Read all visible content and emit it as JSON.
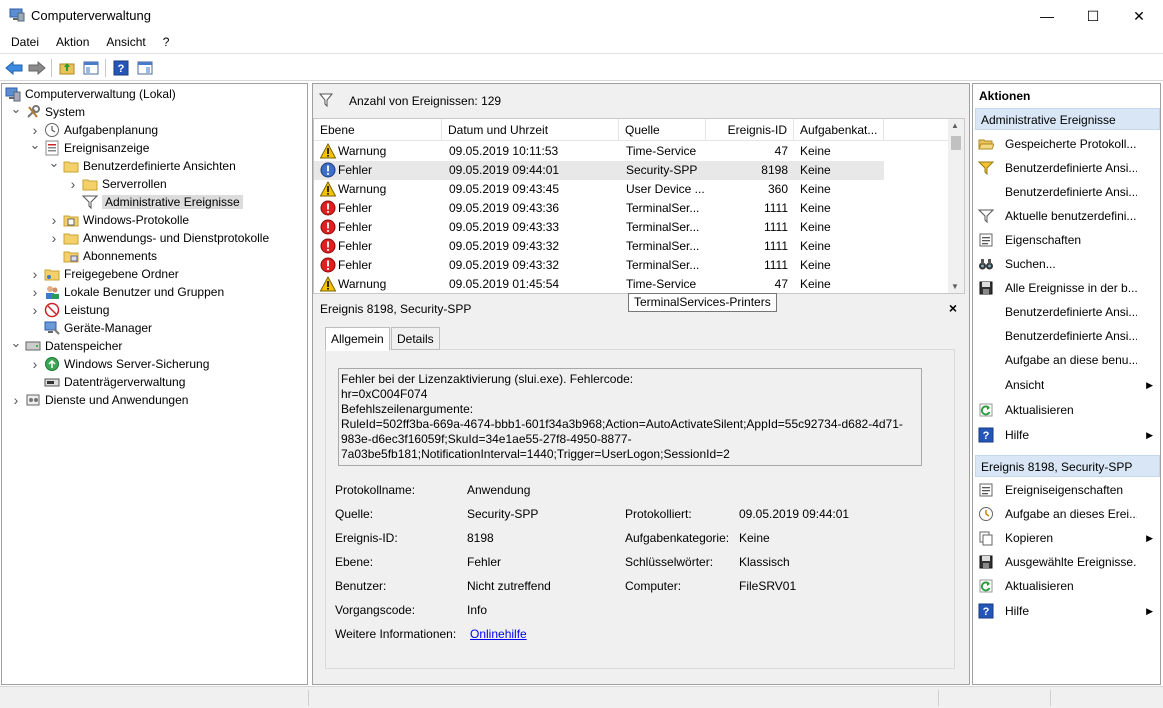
{
  "window": {
    "title": "Computerverwaltung",
    "minimize": "—",
    "maximize": "☐",
    "close": "✕"
  },
  "menu": [
    "Datei",
    "Aktion",
    "Ansicht",
    "?"
  ],
  "tree": {
    "items": [
      {
        "label": "Computerverwaltung (Lokal)",
        "level": 0,
        "exp": "",
        "icon": "computer-management-icon"
      },
      {
        "label": "System",
        "level": 1,
        "exp": "open",
        "icon": "tools-icon"
      },
      {
        "label": "Aufgabenplanung",
        "level": 2,
        "exp": "closed",
        "icon": "clock-icon"
      },
      {
        "label": "Ereignisanzeige",
        "level": 2,
        "exp": "open",
        "icon": "event-viewer-icon"
      },
      {
        "label": "Benutzerdefinierte Ansichten",
        "level": 3,
        "exp": "open",
        "icon": "folder-icon"
      },
      {
        "label": "Serverrollen",
        "level": 4,
        "exp": "closed",
        "icon": "folder-icon"
      },
      {
        "label": "Administrative Ereignisse",
        "level": 4,
        "exp": "",
        "icon": "filter-icon",
        "selected": true
      },
      {
        "label": "Windows-Protokolle",
        "level": 3,
        "exp": "closed",
        "icon": "log-folder-icon"
      },
      {
        "label": "Anwendungs- und Dienstprotokolle",
        "level": 3,
        "exp": "closed",
        "icon": "folder-icon"
      },
      {
        "label": "Abonnements",
        "level": 3,
        "exp": "",
        "icon": "subscription-icon"
      },
      {
        "label": "Freigegebene Ordner",
        "level": 2,
        "exp": "closed",
        "icon": "shared-folder-icon"
      },
      {
        "label": "Lokale Benutzer und Gruppen",
        "level": 2,
        "exp": "closed",
        "icon": "users-icon"
      },
      {
        "label": "Leistung",
        "level": 2,
        "exp": "closed",
        "icon": "performance-icon"
      },
      {
        "label": "Geräte-Manager",
        "level": 2,
        "exp": "",
        "icon": "device-manager-icon"
      },
      {
        "label": "Datenspeicher",
        "level": 1,
        "exp": "open",
        "icon": "storage-icon"
      },
      {
        "label": "Windows Server-Sicherung",
        "level": 2,
        "exp": "closed",
        "icon": "backup-icon"
      },
      {
        "label": "Datenträgerverwaltung",
        "level": 2,
        "exp": "",
        "icon": "disk-icon"
      },
      {
        "label": "Dienste und Anwendungen",
        "level": 1,
        "exp": "closed",
        "icon": "services-icon"
      }
    ]
  },
  "events": {
    "count_label": "Anzahl von Ereignissen: 129",
    "columns": [
      "Ebene",
      "Datum und Uhrzeit",
      "Quelle",
      "Ereignis-ID",
      "Aufgabenkat..."
    ],
    "rows": [
      {
        "level": "Warnung",
        "type": "warning",
        "date": "09.05.2019 10:11:53",
        "source": "Time-Service",
        "id": "47",
        "task": "Keine"
      },
      {
        "level": "Fehler",
        "type": "error-blue",
        "date": "09.05.2019 09:44:01",
        "source": "Security-SPP",
        "id": "8198",
        "task": "Keine"
      },
      {
        "level": "Warnung",
        "type": "warning",
        "date": "09.05.2019 09:43:45",
        "source": "User Device ...",
        "id": "360",
        "task": "Keine"
      },
      {
        "level": "Fehler",
        "type": "error",
        "date": "09.05.2019 09:43:36",
        "source": "TerminalSer...",
        "id": "1111",
        "task": "Keine"
      },
      {
        "level": "Fehler",
        "type": "error",
        "date": "09.05.2019 09:43:33",
        "source": "TerminalSer...",
        "id": "1111",
        "task": "Keine"
      },
      {
        "level": "Fehler",
        "type": "error",
        "date": "09.05.2019 09:43:32",
        "source": "TerminalSer...",
        "id": "1111",
        "task": "Keine"
      },
      {
        "level": "Fehler",
        "type": "error",
        "date": "09.05.2019 09:43:32",
        "source": "TerminalSer...",
        "id": "1111",
        "task": "Keine"
      },
      {
        "level": "Warnung",
        "type": "warning",
        "date": "09.05.2019 01:45:54",
        "source": "Time-Service",
        "id": "47",
        "task": "Keine"
      }
    ],
    "tooltip": "TerminalServices-Printers"
  },
  "detail": {
    "title": "Ereignis 8198, Security-SPP",
    "close": "×",
    "tabs": [
      "Allgemein",
      "Details"
    ],
    "message": "Fehler bei der Lizenzaktivierung (slui.exe). Fehlercode:\nhr=0xC004F074\nBefehlszeilenargumente:\nRuleId=502ff3ba-669a-4674-bbb1-601f34a3b968;Action=AutoActivateSilent;AppId=55c92734-d682-4d71-983e-d6ec3f16059f;SkuId=34e1ae55-27f8-4950-8877-7a03be5fb181;NotificationInterval=1440;Trigger=UserLogon;SessionId=2",
    "fields": {
      "protokollname_label": "Protokollname:",
      "protokollname": "Anwendung",
      "quelle_label": "Quelle:",
      "quelle": "Security-SPP",
      "protokolliert_label": "Protokolliert:",
      "protokolliert": "09.05.2019 09:44:01",
      "ereignisid_label": "Ereignis-ID:",
      "ereignisid": "8198",
      "aufgabenkategorie_label": "Aufgabenkategorie:",
      "aufgabenkategorie": "Keine",
      "ebene_label": "Ebene:",
      "ebene": "Fehler",
      "schluesselwoerter_label": "Schlüsselwörter:",
      "schluesselwoerter": "Klassisch",
      "benutzer_label": "Benutzer:",
      "benutzer": "Nicht zutreffend",
      "computer_label": "Computer:",
      "computer": "FileSRV01",
      "vorgangscode_label": "Vorgangscode:",
      "vorgangscode": "Info",
      "weitere_label": "Weitere Informationen:",
      "weitere_link": "Onlinehilfe"
    }
  },
  "actions": {
    "title": "Aktionen",
    "section1": "Administrative Ereignisse",
    "items1": [
      {
        "label": "Gespeicherte Protokoll...",
        "icon": "open-folder-icon"
      },
      {
        "label": "Benutzerdefinierte Ansi...",
        "icon": "filter-create-icon"
      },
      {
        "label": "Benutzerdefinierte Ansi...",
        "icon": ""
      },
      {
        "label": "Aktuelle benutzerdefini...",
        "icon": "filter-icon"
      },
      {
        "label": "Eigenschaften",
        "icon": "properties-icon"
      },
      {
        "label": "Suchen...",
        "icon": "binoculars-icon"
      },
      {
        "label": "Alle Ereignisse in der b...",
        "icon": "save-icon"
      },
      {
        "label": "Benutzerdefinierte Ansi...",
        "icon": ""
      },
      {
        "label": "Benutzerdefinierte Ansi...",
        "icon": ""
      },
      {
        "label": "Aufgabe an diese benu...",
        "icon": ""
      },
      {
        "label": "Ansicht",
        "icon": "",
        "submenu": true
      },
      {
        "label": "Aktualisieren",
        "icon": "refresh-icon"
      },
      {
        "label": "Hilfe",
        "icon": "help-icon",
        "submenu": true
      }
    ],
    "section2": "Ereignis 8198, Security-SPP",
    "items2": [
      {
        "label": "Ereigniseigenschaften",
        "icon": "properties-icon"
      },
      {
        "label": "Aufgabe an dieses Erei...",
        "icon": "task-icon"
      },
      {
        "label": "Kopieren",
        "icon": "copy-icon",
        "submenu": true
      },
      {
        "label": "Ausgewählte Ereignisse...",
        "icon": "save-icon"
      },
      {
        "label": "Aktualisieren",
        "icon": "refresh-icon"
      },
      {
        "label": "Hilfe",
        "icon": "help-icon",
        "submenu": true
      }
    ]
  },
  "colors": {
    "section_bg": "#d9e6f5",
    "link": "#0000ee",
    "error": "#e02020",
    "warning": "#f5c400"
  }
}
